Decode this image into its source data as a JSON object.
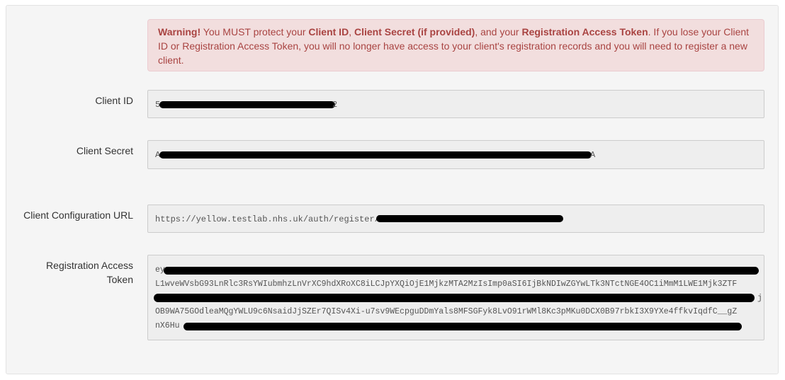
{
  "alert": {
    "warning": "Warning!",
    "t1": " You MUST protect your ",
    "client_id": "Client ID",
    "t2": ", ",
    "client_secret": "Client Secret (if provided)",
    "t3": ", and your ",
    "rat": "Registration Access Token",
    "t4": ". If you lose your Client ID or Registration Access Token, you will no longer have access to your client's registration records and you will need to register a new client."
  },
  "fields": {
    "client_id": {
      "label": "Client ID",
      "prefix": "5",
      "suffix": "2"
    },
    "client_secret": {
      "label": "Client Secret",
      "prefix": "A",
      "suffix": "A"
    },
    "config_url": {
      "label": "Client Configuration URL",
      "value": "https://yellow.testlab.nhs.uk/auth/register/"
    },
    "rat": {
      "label_line1": "Registration Access",
      "label_line2": "Token",
      "lines": [
        "ey",
        "L1wveWVsbG93LnRlc3RsYWIubmhzLnVrXC9hdXRoXC8iLCJpYXQiOjE1MjkzMTA2MzIsImp0aSI6IjBkNDIwZGYwLTk3NTctNGE4OC1iMmM1LWE1Mjk3ZTF",
        "j",
        "OB9WA75GOdleaMQgYWLU9c6NsaidJjSZEr7QISv4Xi-u7sv9WEcpguDDmYals8MFSGFyk8LvO91rWMl8Kc3pMKu0DCX0B97rbkI3X9YXe4ffkvIqdfC__gZ",
        "nX6Hu"
      ]
    }
  }
}
